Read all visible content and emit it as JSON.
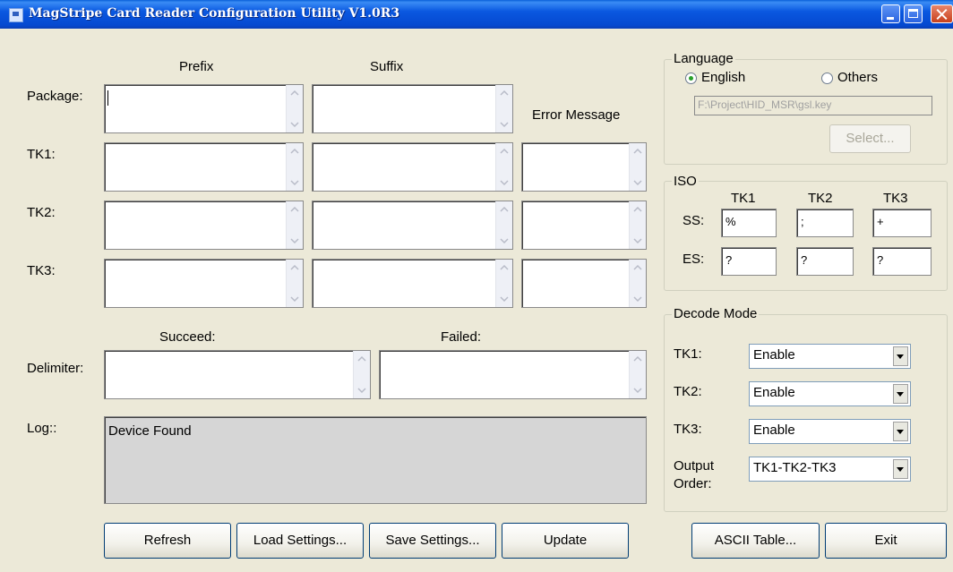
{
  "window": {
    "title": "MagStripe Card Reader Configuration Utility V1.0R3"
  },
  "headers": {
    "prefix": "Prefix",
    "suffix": "Suffix",
    "error_message": "Error Message",
    "succeed": "Succeed:",
    "failed": "Failed:"
  },
  "rows": {
    "package": "Package:",
    "tk1": "TK1:",
    "tk2": "TK2:",
    "tk3": "TK3:",
    "delimiter": "Delimiter:",
    "log": "Log::"
  },
  "log": {
    "text": "Device Found"
  },
  "language": {
    "title": "Language",
    "english": "English",
    "others": "Others",
    "selected": "English",
    "key_path": "F:\\Project\\HID_MSR\\gsl.key",
    "select_button": "Select..."
  },
  "iso": {
    "title": "ISO",
    "col_tk1": "TK1",
    "col_tk2": "TK2",
    "col_tk3": "TK3",
    "ss_label": "SS:",
    "es_label": "ES:",
    "ss": {
      "tk1": "%",
      "tk2": ";",
      "tk3": "+"
    },
    "es": {
      "tk1": "?",
      "tk2": "?",
      "tk3": "?"
    }
  },
  "decode": {
    "title": "Decode Mode",
    "tk1_label": "TK1:",
    "tk2_label": "TK2:",
    "tk3_label": "TK3:",
    "output_label": "Output Order:",
    "tk1": "Enable",
    "tk2": "Enable",
    "tk3": "Enable",
    "output": "TK1-TK2-TK3"
  },
  "buttons": {
    "refresh": "Refresh",
    "load": "Load Settings...",
    "save": "Save Settings...",
    "update": "Update",
    "ascii": "ASCII Table...",
    "exit": "Exit"
  }
}
